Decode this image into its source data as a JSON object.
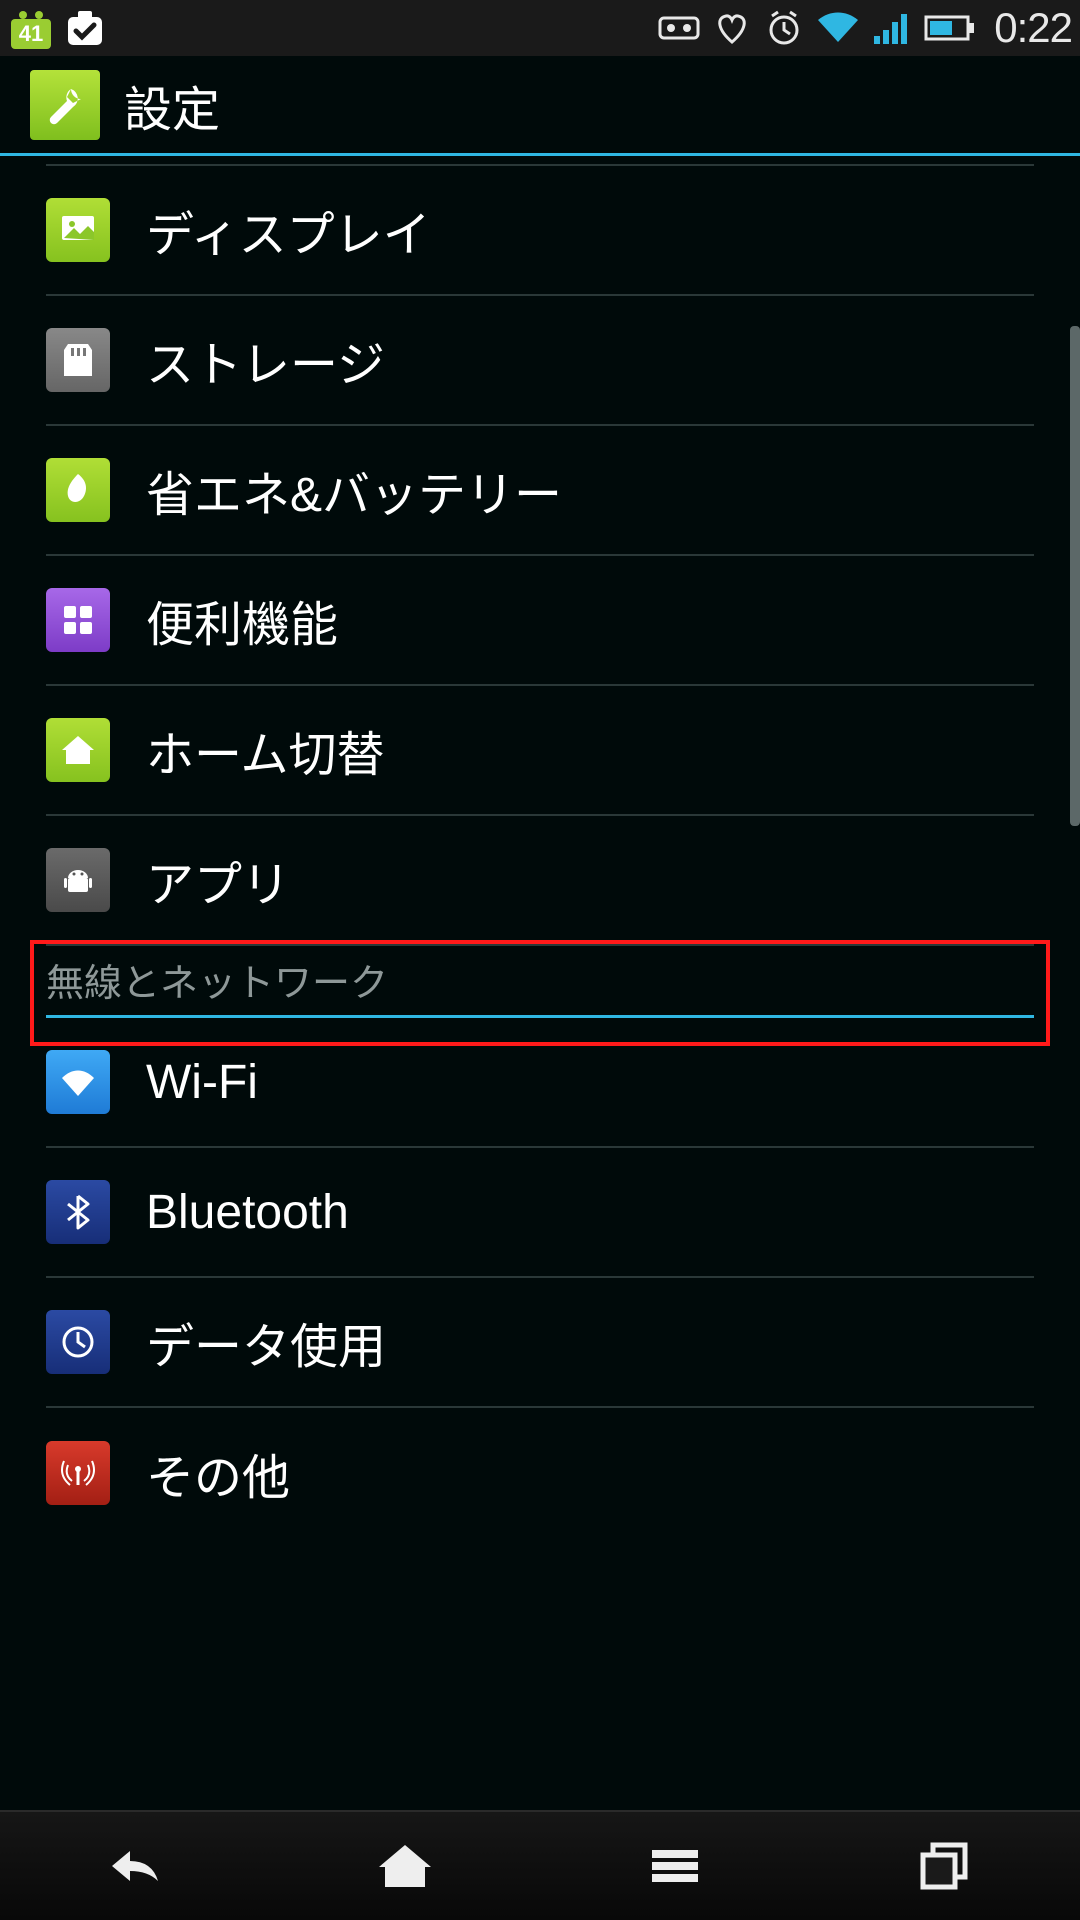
{
  "status_bar": {
    "battery_badge": "41",
    "time": "0:22"
  },
  "header": {
    "title": "設定",
    "icon": "wrench-icon"
  },
  "items": [
    {
      "icon": "display-icon",
      "icon_class": "ic-green",
      "label": "ディスプレイ"
    },
    {
      "icon": "storage-icon",
      "icon_class": "ic-gray",
      "label": "ストレージ"
    },
    {
      "icon": "battery-icon",
      "icon_class": "ic-green",
      "label": "省エネ&バッテリー"
    },
    {
      "icon": "grid-icon",
      "icon_class": "ic-purple",
      "label": "便利機能"
    },
    {
      "icon": "home-icon",
      "icon_class": "ic-green",
      "label": "ホーム切替"
    },
    {
      "icon": "apps-icon",
      "icon_class": "ic-dark",
      "label": "アプリ"
    }
  ],
  "section": {
    "label": "無線とネットワーク"
  },
  "items2": [
    {
      "icon": "wifi-icon",
      "icon_class": "ic-blue",
      "label": "Wi-Fi"
    },
    {
      "icon": "bluetooth-icon",
      "icon_class": "ic-navy",
      "label": "Bluetooth"
    },
    {
      "icon": "data-icon",
      "icon_class": "ic-navy",
      "label": "データ使用"
    },
    {
      "icon": "more-icon",
      "icon_class": "ic-red",
      "label": "その他"
    }
  ],
  "highlighted_index": 5,
  "colors": {
    "accent": "#2fb7e2",
    "highlight": "#ff1a1a"
  }
}
